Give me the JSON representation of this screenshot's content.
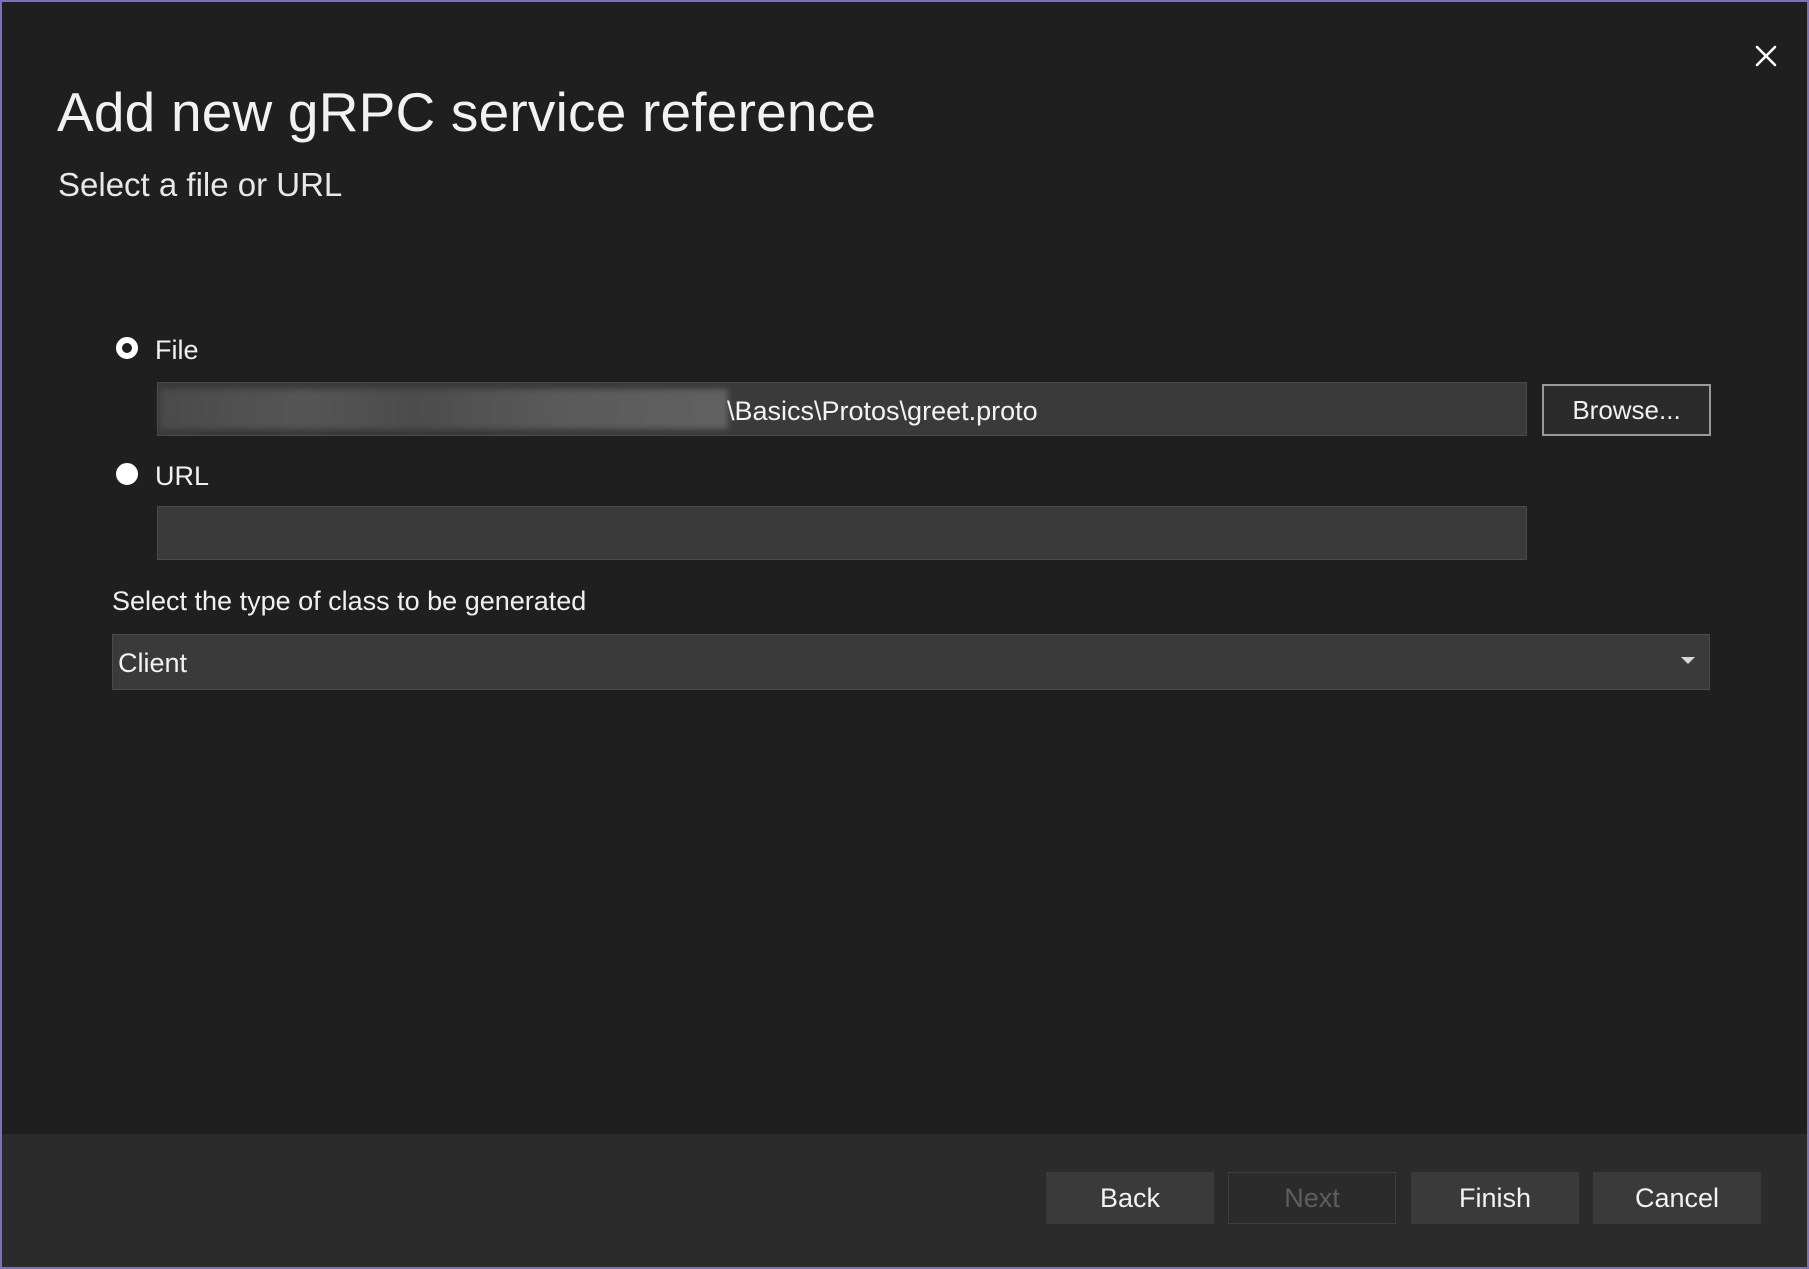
{
  "dialog": {
    "title": "Add new gRPC service reference",
    "subtitle": "Select a file or URL",
    "close_icon": "close-icon"
  },
  "source": {
    "file": {
      "label": "File",
      "selected": true,
      "path_visible": "\\Basics\\Protos\\greet.proto",
      "browse_label": "Browse..."
    },
    "url": {
      "label": "URL",
      "selected": false,
      "value": ""
    }
  },
  "class_type": {
    "label": "Select the type of class to be generated",
    "selected": "Client"
  },
  "footer": {
    "back_label": "Back",
    "next_label": "Next",
    "finish_label": "Finish",
    "cancel_label": "Cancel"
  },
  "colors": {
    "background": "#1f1f1f",
    "footer": "#2b2b2b",
    "field": "#3a3a3a",
    "border_accent": "#7f6fc2"
  }
}
